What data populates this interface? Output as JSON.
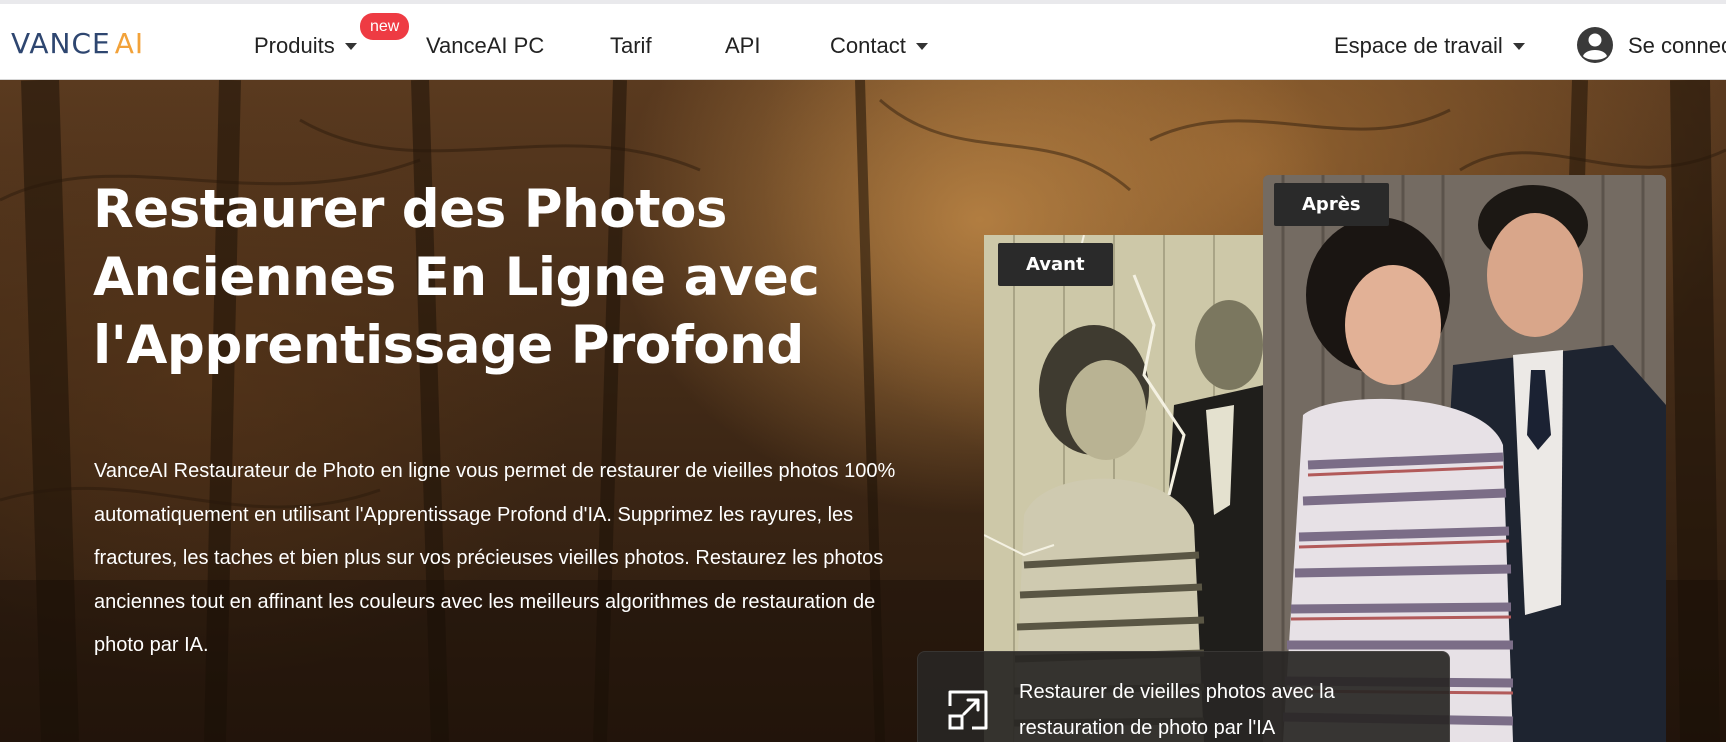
{
  "nav": {
    "logo_left": "VANCE",
    "logo_right": "AI",
    "items": [
      {
        "label": "Produits",
        "has_caret": true
      },
      {
        "label": "VanceAI PC",
        "has_caret": false
      },
      {
        "label": "Tarif",
        "has_caret": false
      },
      {
        "label": "API",
        "has_caret": false
      },
      {
        "label": "Contact",
        "has_caret": true
      }
    ],
    "new_badge": "new",
    "workspace": "Espace de travail",
    "signin": "Se connec"
  },
  "hero": {
    "title": "Restaurer des Photos Anciennes En Ligne avec l'Apprentissage Profond",
    "description": "VanceAI Restaurateur de Photo en ligne vous permet de restaurer de vieilles photos 100% automatiquement en utilisant l'Apprentissage Profond d'IA. Supprimez les rayures, les fractures, les taches et bien plus sur vos précieuses vieilles photos. Restaurez les photos anciennes tout en affinant les couleurs avec les meilleurs algorithmes de restauration de photo par IA.",
    "before_label": "Avant",
    "after_label": "Après",
    "card_text": "Restaurer de vieilles photos avec la restauration de photo par l'IA"
  },
  "colors": {
    "logo_blue": "#2e4670",
    "logo_orange": "#f2a23a",
    "badge_red": "#ee3b43",
    "tag_bg": "#2a2a2a"
  },
  "icons": {
    "user": "user-circle-icon",
    "expand": "expand-arrow-icon",
    "caret": "caret-down-icon"
  }
}
